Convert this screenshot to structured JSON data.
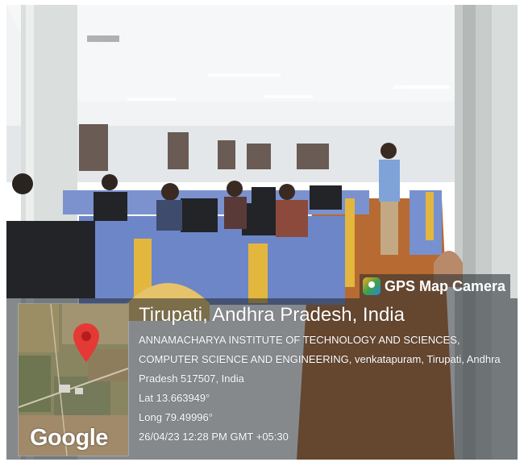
{
  "scene": {
    "description_colors": {
      "wall": "#e9ebec",
      "desk_blue": "#6f86c8",
      "desk_yellow": "#e2b53b",
      "floor": "#b5652c"
    }
  },
  "badge": {
    "icon": "gps-map-camera-icon",
    "label": "GPS Map Camera"
  },
  "map": {
    "logo_text": "Google",
    "pin_icon": "location-pin-icon",
    "pin_color": "#e53935"
  },
  "location": {
    "title": "Tirupati, Andhra Pradesh, India",
    "address": "ANNAMACHARYA INSTITUTE OF TECHNOLOGY AND SCIENCES, COMPUTER SCIENCE AND ENGINEERING, venkatapuram, Tirupati, Andhra Pradesh 517507, India",
    "lat": "Lat 13.663949°",
    "long": "Long 79.49996°",
    "datetime": "26/04/23 12:28 PM GMT +05:30"
  }
}
